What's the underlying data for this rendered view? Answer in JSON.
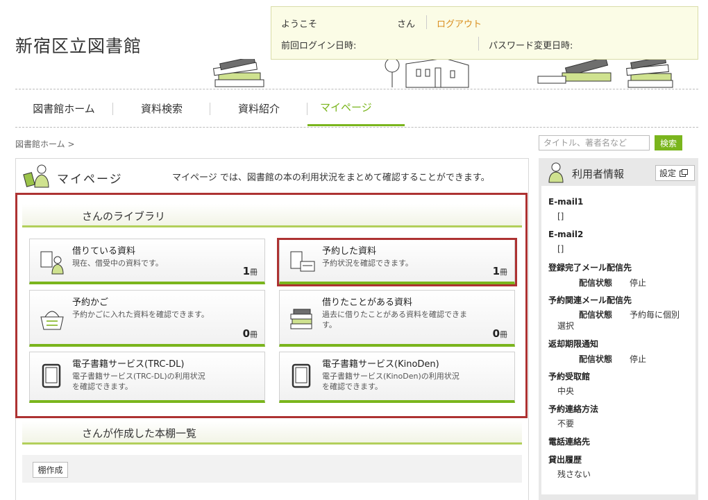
{
  "site": {
    "title": "新宿区立図書館"
  },
  "login": {
    "welcome": "ようこそ",
    "san": "さん",
    "logout": "ログアウト",
    "last_login_label": "前回ログイン日時:",
    "password_change_label": "パスワード変更日時:"
  },
  "nav": {
    "items": [
      {
        "label": "図書館ホーム"
      },
      {
        "label": "資料検索"
      },
      {
        "label": "資料紹介"
      },
      {
        "label": "マイページ",
        "active": true
      }
    ]
  },
  "breadcrumb": {
    "home": "図書館ホーム >"
  },
  "search": {
    "placeholder": "タイトル、著者名など",
    "button": "検索"
  },
  "mypage": {
    "title": "マイページ",
    "description": "マイページ では、図書館の本の利用状況をまとめて確認することができます。",
    "library_heading": "さんのライブラリ",
    "cards": [
      {
        "title": "借りている資料",
        "desc": "現在、借受中の資料です。",
        "count": "1",
        "unit": "冊",
        "icon": "borrowed-books-icon"
      },
      {
        "title": "予約した資料",
        "desc": "予約状況を確認できます。",
        "count": "1",
        "unit": "冊",
        "icon": "reserved-books-icon"
      },
      {
        "title": "予約かご",
        "desc": "予約かごに入れた資料を確認できます。",
        "count": "0",
        "unit": "冊",
        "icon": "basket-icon"
      },
      {
        "title": "借りたことがある資料",
        "desc": "過去に借りたことがある資料を確認できます。",
        "count": "0",
        "unit": "冊",
        "icon": "history-books-icon"
      },
      {
        "title": "電子書籍サービス(TRC-DL)",
        "desc": "電子書籍サービス(TRC-DL)の利用状況を確認できます。",
        "icon": "tablet-icon"
      },
      {
        "title": "電子書籍サービス(KinoDen)",
        "desc": "電子書籍サービス(KinoDen)の利用状況を確認できます。",
        "icon": "tablet-icon"
      }
    ],
    "bookshelf_heading": "さんが作成した本棚一覧",
    "create_shelf_button": "棚作成"
  },
  "user_info": {
    "title": "利用者情報",
    "settings_button": "設定",
    "email1_label": "E-mail1",
    "email1_value": "[]",
    "email2_label": "E-mail2",
    "email2_value": "[]",
    "reg_mail_label": "登録完了メール配信先",
    "reg_mail_status_label": "配信状態",
    "reg_mail_status_value": "停止",
    "reserve_mail_label": "予約関連メール配信先",
    "reserve_mail_status_label": "配信状態",
    "reserve_mail_status_value": "予約毎に個別",
    "reserve_mail_status_value2": "選択",
    "due_notice_label": "返却期限通知",
    "due_notice_status_label": "配信状態",
    "due_notice_status_value": "停止",
    "pickup_label": "予約受取館",
    "pickup_value": "中央",
    "contact_label": "予約連絡方法",
    "contact_value": "不要",
    "phone_label": "電話連絡先",
    "history_label": "貸出履歴",
    "history_value": "残さない"
  },
  "colors": {
    "accent": "#7ab51d",
    "highlight_frame": "#ad3232",
    "logout": "#d98e1e"
  }
}
